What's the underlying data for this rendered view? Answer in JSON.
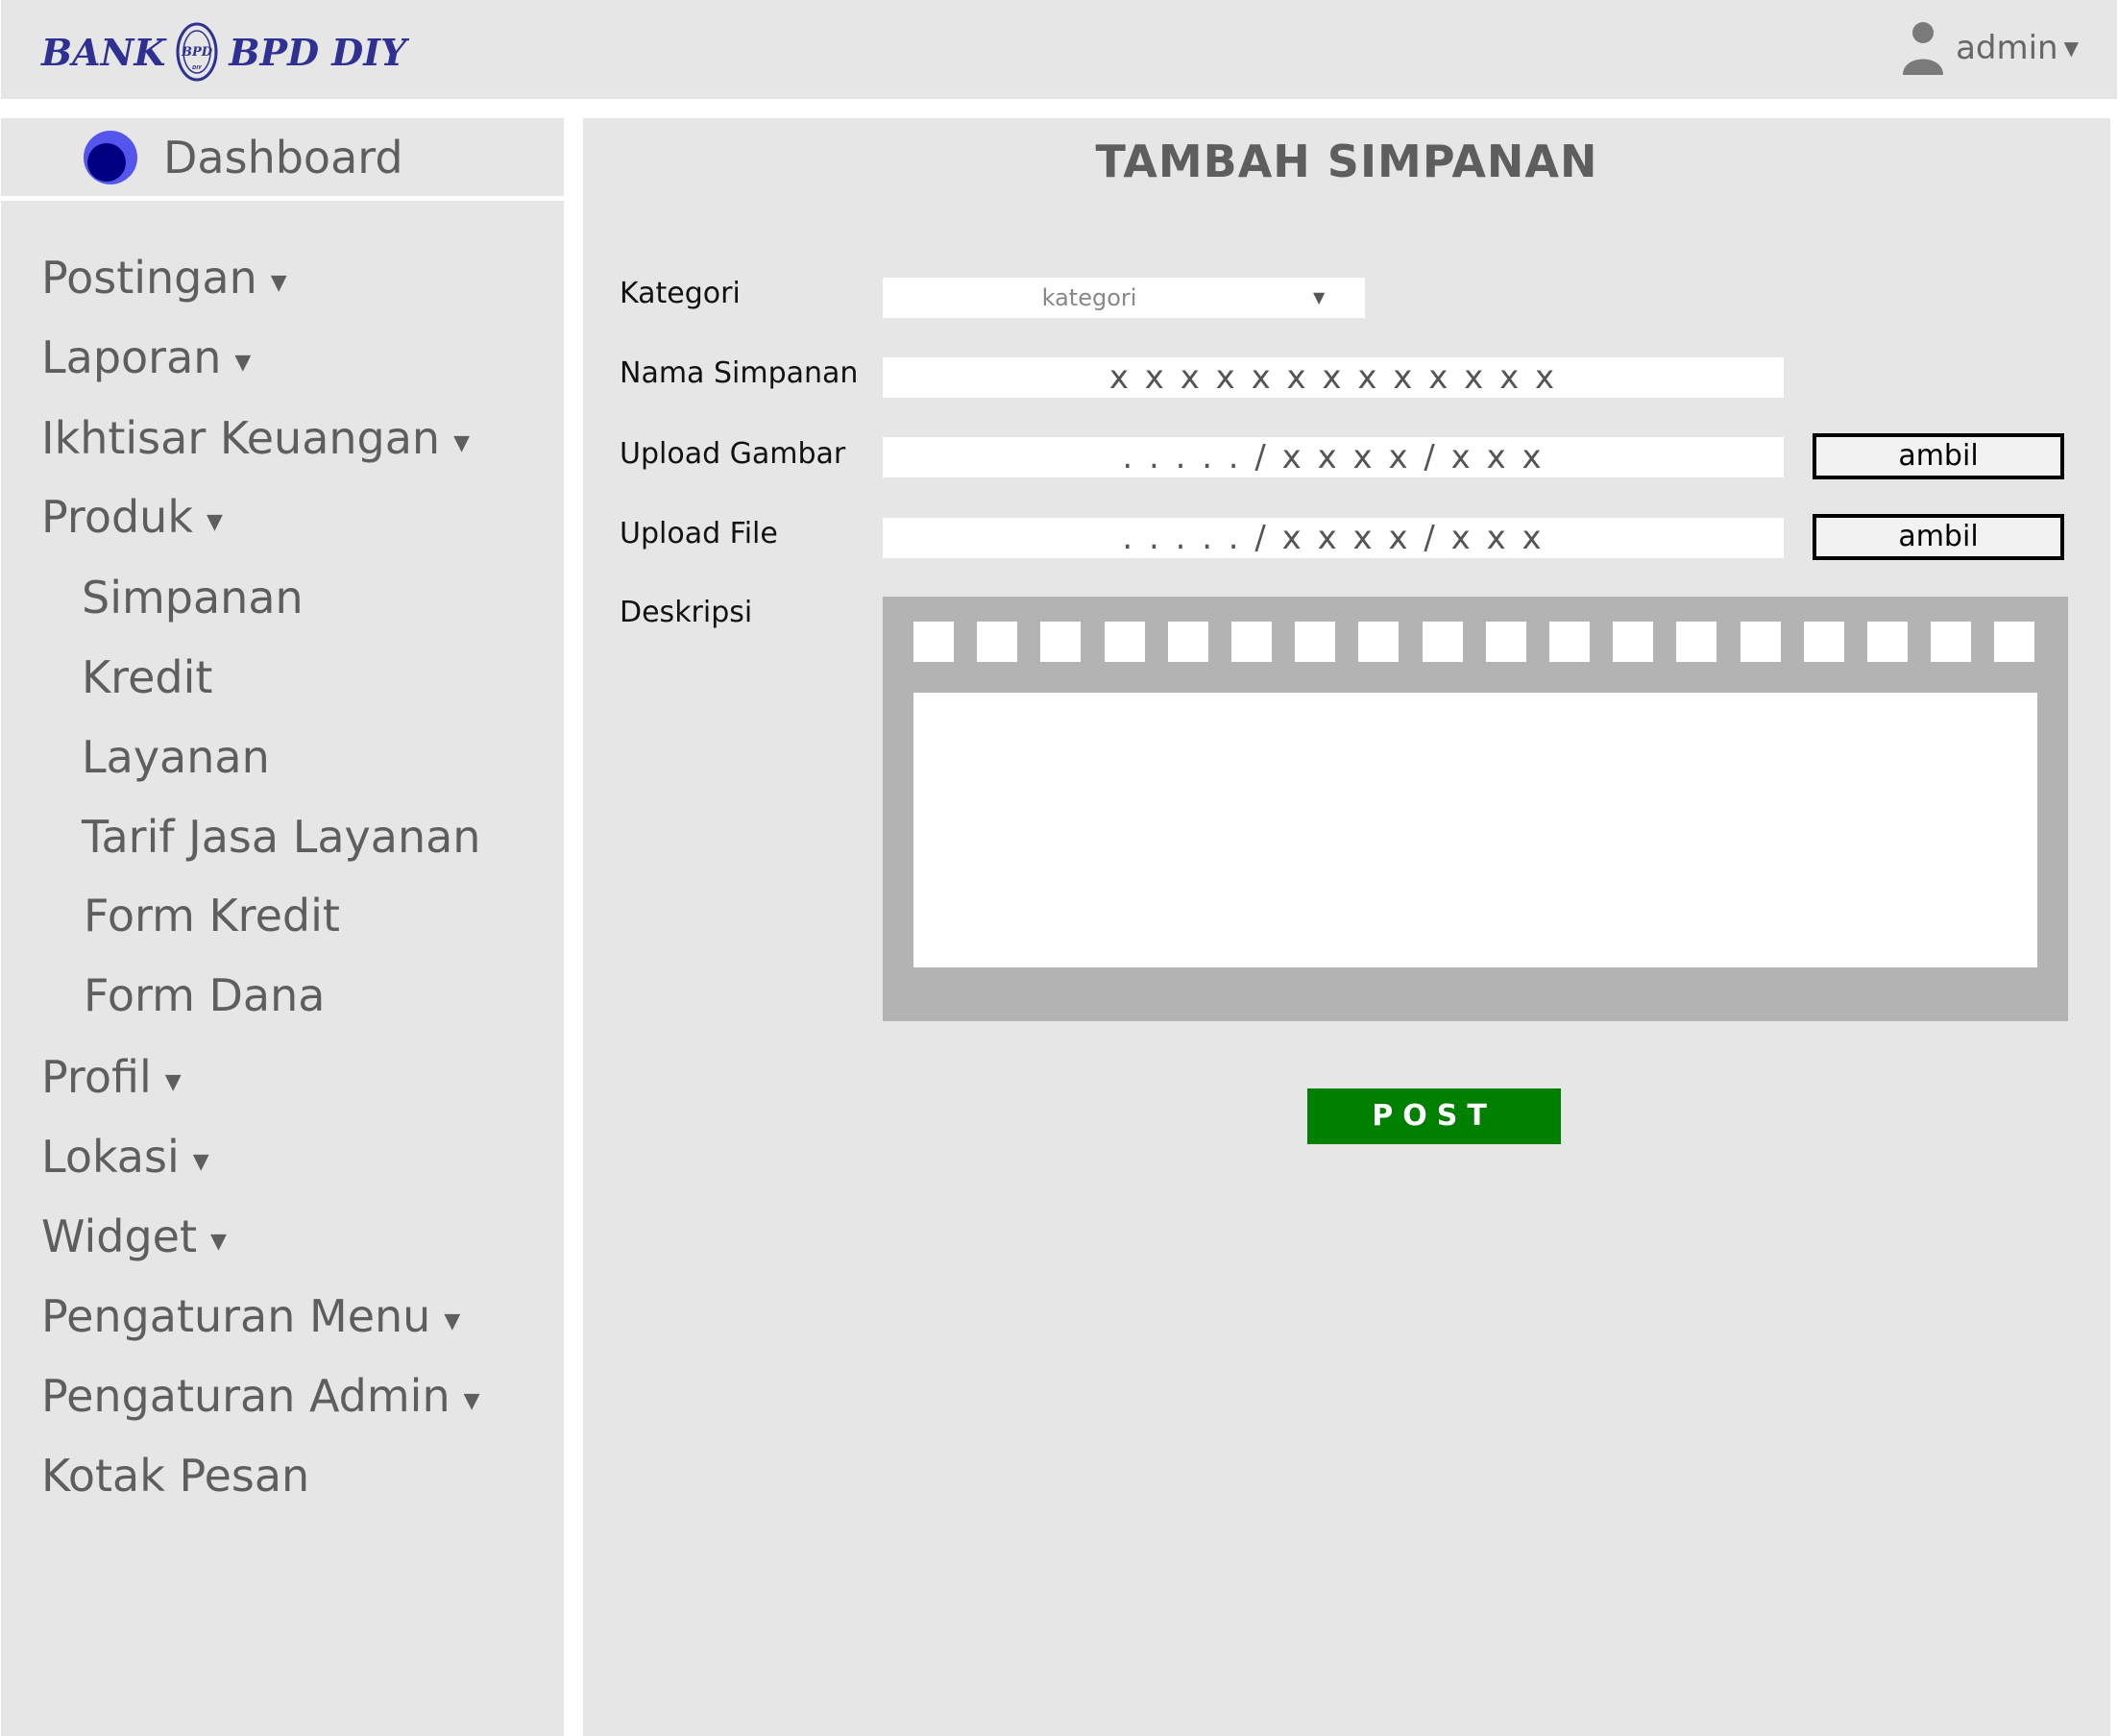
{
  "header": {
    "logo_left": "BANK",
    "logo_emblem": "BPD DIY",
    "logo_right": "BPD DIY",
    "user_name": "admin",
    "user_icon": "user-icon",
    "caret_icon": "caret-down-icon"
  },
  "dashboard": {
    "label": "Dashboard",
    "icon": "dashboard-circle-icon",
    "icon_color": "#4d4dff"
  },
  "sidebar": {
    "caret": "▼",
    "items": [
      {
        "label": "Postingan",
        "has_submenu": true
      },
      {
        "label": "Laporan",
        "has_submenu": true
      },
      {
        "label": "Ikhtisar Keuangan",
        "has_submenu": true
      },
      {
        "label": "Produk",
        "has_submenu": true
      },
      {
        "label": "Simpanan",
        "has_submenu": false
      },
      {
        "label": "Kredit",
        "has_submenu": false
      },
      {
        "label": "Layanan",
        "has_submenu": false
      },
      {
        "label": "Tarif Jasa Layanan",
        "has_submenu": false
      },
      {
        "label": "Form Kredit",
        "has_submenu": false
      },
      {
        "label": "Form Dana",
        "has_submenu": false
      },
      {
        "label": "Profil",
        "has_submenu": true
      },
      {
        "label": "Lokasi",
        "has_submenu": true
      },
      {
        "label": "Widget",
        "has_submenu": true
      },
      {
        "label": "Pengaturan Menu",
        "has_submenu": true
      },
      {
        "label": "Pengaturan Admin",
        "has_submenu": true
      },
      {
        "label": "Kotak Pesan",
        "has_submenu": false
      }
    ]
  },
  "form": {
    "title": "TAMBAH SIMPANAN",
    "kategori_label": "Kategori",
    "kategori_value": "kategori",
    "kategori_caret": "▼",
    "nama_label": "Nama Simpanan",
    "nama_value": "x x x x x x x x x x x x x",
    "gambar_label": "Upload Gambar",
    "gambar_value": ". . . . .  / x x x x / x x x",
    "gambar_button": "ambil",
    "file_label": "Upload File",
    "file_value": ". . . . .  / x x x x / x x x",
    "file_button": "ambil",
    "deskripsi_label": "Deskripsi",
    "toolbar_button_count": 18,
    "post_button": "POST",
    "post_color": "#008000"
  }
}
